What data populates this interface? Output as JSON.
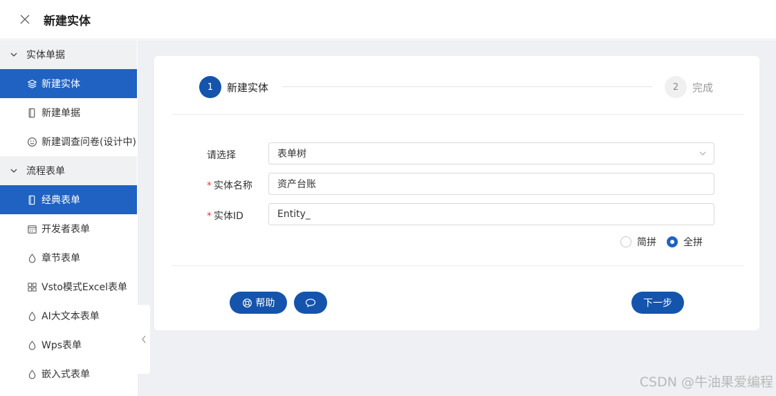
{
  "header": {
    "title": "新建实体"
  },
  "sidebar": {
    "groups": [
      {
        "label": "实体单据",
        "items": [
          {
            "label": "新建实体",
            "icon": "layers-icon"
          },
          {
            "label": "新建单据",
            "icon": "document-icon"
          },
          {
            "label": "新建调查问卷(设计中)",
            "icon": "smile-icon"
          }
        ]
      },
      {
        "label": "流程表单",
        "items": [
          {
            "label": "经典表单",
            "icon": "book-icon"
          },
          {
            "label": "开发者表单",
            "icon": "calendar-icon"
          },
          {
            "label": "章节表单",
            "icon": "drop-icon"
          },
          {
            "label": "Vsto模式Excel表单",
            "icon": "grid-icon"
          },
          {
            "label": "AI大文本表单",
            "icon": "drop-icon"
          },
          {
            "label": "Wps表单",
            "icon": "drop-icon"
          },
          {
            "label": "嵌入式表单",
            "icon": "drop-icon"
          }
        ]
      }
    ]
  },
  "steps": [
    {
      "number": "1",
      "label": "新建实体",
      "status": "active"
    },
    {
      "number": "2",
      "label": "完成",
      "status": "pending"
    }
  ],
  "form": {
    "select": {
      "label": "请选择",
      "value": "表单树"
    },
    "entity_name": {
      "label": "实体名称",
      "value": "资产台账",
      "required": true
    },
    "entity_id": {
      "label": "实体ID",
      "value": "Entity_",
      "required": true
    },
    "pinyin": {
      "options": [
        {
          "label": "简拼",
          "checked": false
        },
        {
          "label": "全拼",
          "checked": true
        }
      ]
    }
  },
  "buttons": {
    "help": "帮助",
    "next": "下一步"
  },
  "watermark": "CSDN @牛油果爱编程",
  "colors": {
    "primary": "#1454ac",
    "active_item": "#1f62c2",
    "background": "#eef0f4",
    "required": "#e53935"
  }
}
